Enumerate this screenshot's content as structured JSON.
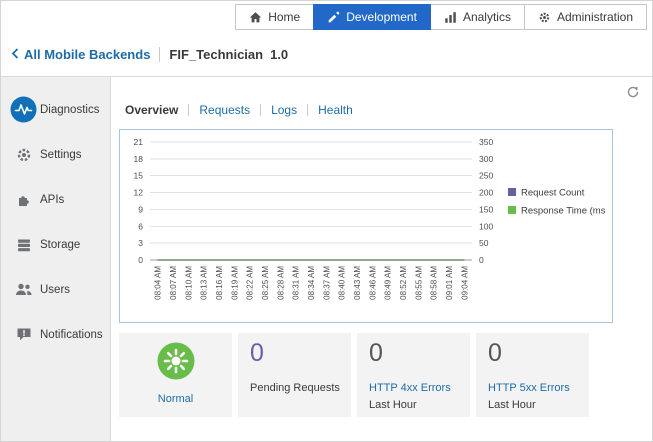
{
  "theme": {
    "accent_blue": "#2268c8",
    "link_blue": "#1e6ca6",
    "purple": "#6b5ea6",
    "green": "#68bd4a"
  },
  "topnav": {
    "items": [
      {
        "label": "Home",
        "icon": "home-icon",
        "active": false
      },
      {
        "label": "Development",
        "icon": "pencil-icon",
        "active": true
      },
      {
        "label": "Analytics",
        "icon": "bar-chart-icon",
        "active": false
      },
      {
        "label": "Administration",
        "icon": "gear-icon",
        "active": false
      }
    ]
  },
  "breadcrumb": {
    "back_label": "All Mobile Backends",
    "backend_name": "FIF_Technician",
    "backend_version": "1.0"
  },
  "sidebar": {
    "items": [
      {
        "label": "Diagnostics",
        "icon": "pulse-icon",
        "active": true
      },
      {
        "label": "Settings",
        "icon": "gear-icon",
        "active": false
      },
      {
        "label": "APIs",
        "icon": "puzzle-icon",
        "active": false
      },
      {
        "label": "Storage",
        "icon": "stack-icon",
        "active": false
      },
      {
        "label": "Users",
        "icon": "users-icon",
        "active": false
      },
      {
        "label": "Notifications",
        "icon": "speech-bubble-icon",
        "active": false
      }
    ]
  },
  "tabs": {
    "items": [
      {
        "label": "Overview",
        "active": true
      },
      {
        "label": "Requests",
        "active": false
      },
      {
        "label": "Logs",
        "active": false
      },
      {
        "label": "Health",
        "active": false
      }
    ]
  },
  "chart_data": {
    "type": "line",
    "x": [
      "08:04 AM",
      "08:07 AM",
      "08:10 AM",
      "08:13 AM",
      "08:16 AM",
      "08:19 AM",
      "08:22 AM",
      "08:25 AM",
      "08:28 AM",
      "08:31 AM",
      "08:34 AM",
      "08:37 AM",
      "08:40 AM",
      "08:43 AM",
      "08:46 AM",
      "08:49 AM",
      "08:52 AM",
      "08:55 AM",
      "08:58 AM",
      "09:01 AM",
      "09:04 AM"
    ],
    "series": [
      {
        "name": "Request Count",
        "color": "#6b5ea6",
        "axis": "left",
        "values": [
          0,
          0,
          0,
          0,
          0,
          0,
          0,
          0,
          0,
          0,
          0,
          0,
          0,
          0,
          0,
          0,
          0,
          0,
          0,
          0,
          0
        ]
      },
      {
        "name": "Response Time (ms",
        "color": "#68bd4a",
        "axis": "right",
        "values": [
          0,
          0,
          0,
          0,
          0,
          0,
          0,
          0,
          0,
          0,
          0,
          0,
          0,
          0,
          0,
          0,
          0,
          0,
          0,
          0,
          0
        ]
      }
    ],
    "left_axis": {
      "ticks": [
        0,
        3,
        6,
        9,
        12,
        15,
        18,
        21
      ],
      "range": [
        0,
        21
      ]
    },
    "right_axis": {
      "ticks": [
        0,
        50,
        100,
        150,
        200,
        250,
        300,
        350
      ],
      "range": [
        0,
        350
      ]
    },
    "grid": true,
    "legend_position": "right"
  },
  "cards": {
    "status": {
      "label": "Normal"
    },
    "pending": {
      "value": "0",
      "label": "Pending Requests"
    },
    "http4xx": {
      "value": "0",
      "label": "HTTP 4xx Errors",
      "sublabel": "Last Hour"
    },
    "http5xx": {
      "value": "0",
      "label": "HTTP 5xx Errors",
      "sublabel": "Last Hour"
    }
  }
}
